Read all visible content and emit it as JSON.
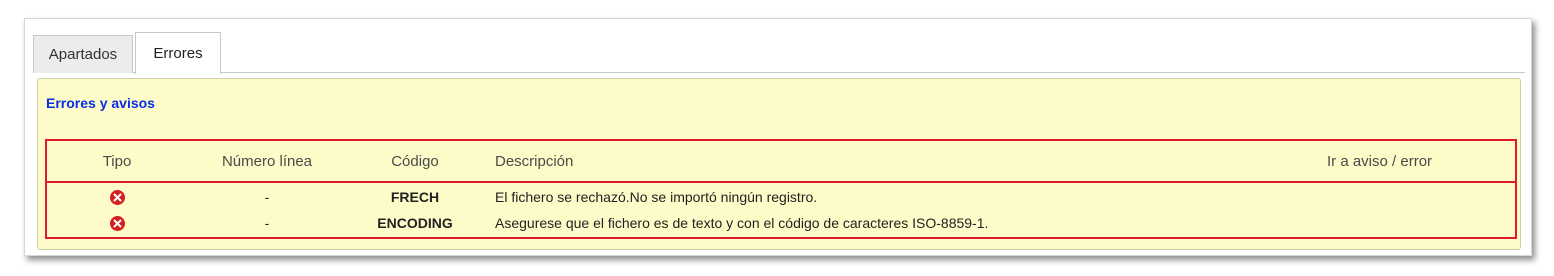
{
  "tabs": [
    {
      "label": "Apartados",
      "active": false
    },
    {
      "label": "Errores",
      "active": true
    }
  ],
  "panel": {
    "title": "Errores y avisos"
  },
  "table": {
    "headers": {
      "tipo": "Tipo",
      "numero_linea": "Número línea",
      "codigo": "Código",
      "descripcion": "Descripción",
      "ir_a": "Ir a aviso / error"
    },
    "rows": [
      {
        "tipo_icon": "error-icon",
        "numero_linea": "-",
        "codigo": "FRECH",
        "descripcion": "El fichero se rechazó.No se importó ningún registro."
      },
      {
        "tipo_icon": "error-icon",
        "numero_linea": "-",
        "codigo": "ENCODING",
        "descripcion": "Asegurese que el fichero es de texto y con el código de caracteres ISO-8859-1."
      }
    ]
  },
  "colors": {
    "panel_bg": "#fdfcc8",
    "grid_border": "#e21b2b",
    "title_blue": "#0a2ee6",
    "error_red": "#d42020"
  }
}
